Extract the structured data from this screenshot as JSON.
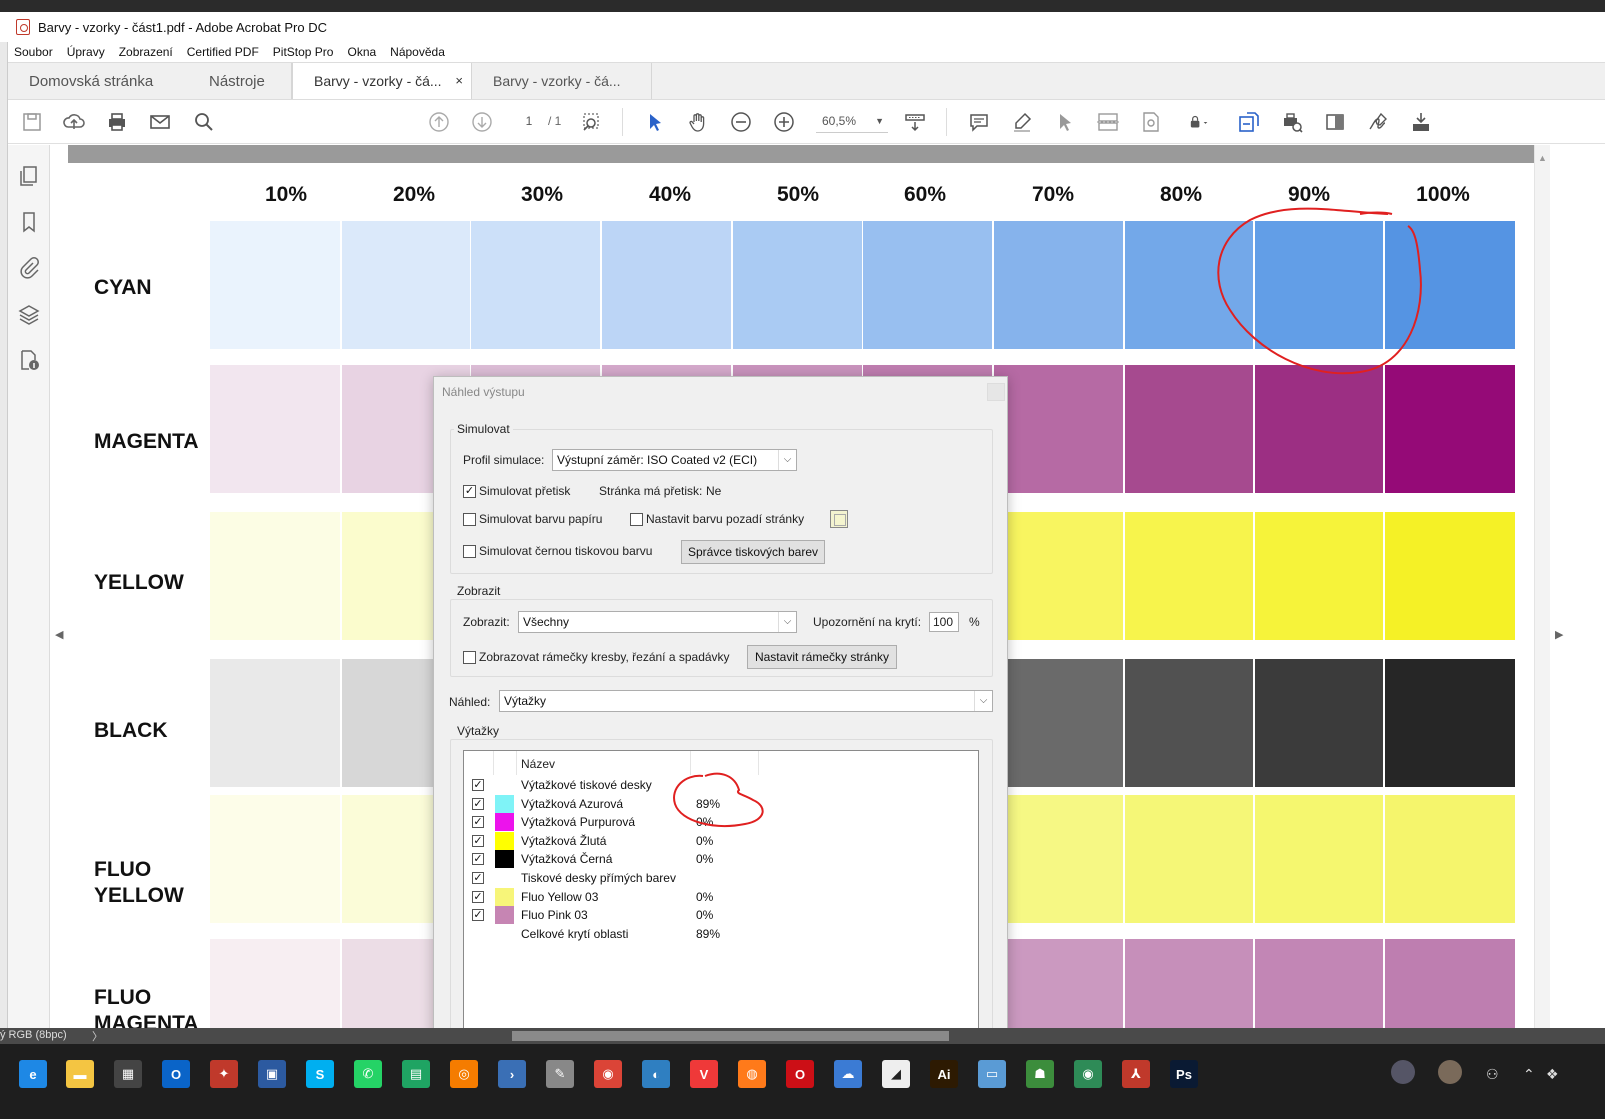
{
  "window": {
    "title": "Barvy - vzorky - část1.pdf - Adobe Acrobat Pro DC"
  },
  "menu": [
    "Soubor",
    "Úpravy",
    "Zobrazení",
    "Certified PDF",
    "PitStop Pro",
    "Okna",
    "Nápověda"
  ],
  "tabs": {
    "home": "Domovská stránka",
    "tools": "Nástroje",
    "doc1": "Barvy - vzorky - čá...",
    "doc2": "Barvy - vzorky - čá...",
    "close": "×"
  },
  "toolbar": {
    "page_current": "1",
    "page_total": "/ 1",
    "zoom": "60,5%"
  },
  "document": {
    "percent_headers": [
      "10%",
      "20%",
      "30%",
      "40%",
      "50%",
      "60%",
      "70%",
      "80%",
      "90%",
      "100%"
    ],
    "rows": [
      {
        "label": "CYAN",
        "colors": [
          "#eaf3fd",
          "#dbe9fa",
          "#cce0f9",
          "#bcd5f6",
          "#aacbf3",
          "#98bff0",
          "#86b3ec",
          "#73a8e9",
          "#629ee7",
          "#5594e3"
        ]
      },
      {
        "label": "MAGENTA",
        "colors": [
          "#f2e6ef",
          "#e8d3e3",
          "#dcbdd6",
          "#d4a9cb",
          "#c993bd",
          "#bf7db0",
          "#b66aa4",
          "#a64a8f",
          "#9c2f83",
          "#950a77"
        ]
      },
      {
        "label": "YELLOW",
        "colors": [
          "#fcfde4",
          "#fbfccd",
          "#fbfbb7",
          "#faf9a0",
          "#f9f88a",
          "#f8f675",
          "#f8f560",
          "#f7f44c",
          "#f6f33a",
          "#f5f126"
        ]
      },
      {
        "label": "BLACK",
        "colors": [
          "#e9e9e9",
          "#d7d7d7",
          "#c4c4c4",
          "#b2b2b2",
          "#9c9c9c",
          "#878787",
          "#6a6a6a",
          "#515151",
          "#3b3b3b",
          "#262626"
        ]
      },
      {
        "label": "FLUO YELLOW",
        "colors": [
          "#fdfde9",
          "#fbfcd8",
          "#fafcc6",
          "#f9fbb6",
          "#f8faa4",
          "#f7f993",
          "#f6f884",
          "#f5f777",
          "#f5f76f",
          "#f5f56c"
        ]
      },
      {
        "label": "FLUO MAGENTA",
        "colors": [
          "#f7eef2",
          "#ecdde6",
          "#e5cfdd",
          "#dec0d5",
          "#d7b1cc",
          "#d0a3c4",
          "#cb99c0",
          "#c68fba",
          "#c286b5",
          "#be7eb0"
        ]
      }
    ]
  },
  "dialog": {
    "title": "Náhled výstupu",
    "simulate": {
      "group": "Simulovat",
      "profile_label": "Profil simulace:",
      "profile_value": "Výstupní záměr: ISO Coated v2 (ECI)",
      "overprint": "Simulovat přetisk",
      "page_overprint_label": "Stránka má přetisk:",
      "page_overprint_value": "Ne",
      "paper_color": "Simulovat barvu papíru",
      "bg_color": "Nastavit barvu pozadí stránky",
      "black_ink": "Simulovat černou tiskovou barvu",
      "ink_manager": "Správce tiskových barev"
    },
    "display": {
      "group": "Zobrazit",
      "show_label": "Zobrazit:",
      "show_value": "Všechny",
      "coverage_label": "Upozornění na krytí:",
      "coverage_value": "100",
      "coverage_unit": "%",
      "boxes": "Zobrazovat rámečky kresby, řezání a spadávky",
      "page_boxes": "Nastavit rámečky stránky"
    },
    "preview_label": "Náhled:",
    "preview_value": "Výtažky",
    "separations": {
      "group": "Výtažky",
      "col_name": "Název",
      "rows": [
        {
          "name": "Výtažkové tiskové desky",
          "pct": "",
          "color": "",
          "checked": true
        },
        {
          "name": "Výtažková Azurová",
          "pct": "89%",
          "color": "#7ff3f7",
          "checked": true
        },
        {
          "name": "Výtažková Purpurová",
          "pct": "0%",
          "color": "#ec13ec",
          "checked": true
        },
        {
          "name": "Výtažková Žlutá",
          "pct": "0%",
          "color": "#ffff00",
          "checked": true
        },
        {
          "name": "Výtažková Černá",
          "pct": "0%",
          "color": "#000000",
          "checked": true
        },
        {
          "name": "Tiskové desky přímých barev",
          "pct": "",
          "color": "",
          "checked": true
        },
        {
          "name": "Fluo Yellow 03",
          "pct": "0%",
          "color": "#f7f579",
          "checked": true
        },
        {
          "name": "Fluo Pink 03",
          "pct": "0%",
          "color": "#c685b3",
          "checked": true
        },
        {
          "name": "Celkové krytí oblasti",
          "pct": "89%",
          "color": "",
          "checked": false
        }
      ]
    }
  },
  "statusbar": {
    "text": "ý RGB (8bpc)"
  },
  "taskbar": {
    "apps": [
      {
        "name": "edge",
        "label": "e",
        "color": "#1e88e5"
      },
      {
        "name": "explorer",
        "label": "▬",
        "color": "#f4c542"
      },
      {
        "name": "store",
        "label": "▦",
        "color": "#444"
      },
      {
        "name": "outlook",
        "label": "O",
        "color": "#0a64c8"
      },
      {
        "name": "app-red",
        "label": "✦",
        "color": "#c0392b"
      },
      {
        "name": "save-app",
        "label": "▣",
        "color": "#2c5aa0"
      },
      {
        "name": "skype",
        "label": "S",
        "color": "#00aff0"
      },
      {
        "name": "whatsapp",
        "label": "✆",
        "color": "#25d366"
      },
      {
        "name": "sheets",
        "label": "▤",
        "color": "#1fa463"
      },
      {
        "name": "app-orange",
        "label": "◎",
        "color": "#f57c00"
      },
      {
        "name": "powershell",
        "label": "›",
        "color": "#3a6fb5"
      },
      {
        "name": "paint",
        "label": "✎",
        "color": "#888"
      },
      {
        "name": "chrome",
        "label": "◉",
        "color": "#db4437"
      },
      {
        "name": "app-blue",
        "label": "◐",
        "color": "#2f7fc1"
      },
      {
        "name": "vivaldi",
        "label": "V",
        "color": "#ef3939"
      },
      {
        "name": "firefox",
        "label": "◍",
        "color": "#ff7a1a"
      },
      {
        "name": "opera",
        "label": "O",
        "color": "#cc0f16"
      },
      {
        "name": "app-cloud",
        "label": "☁",
        "color": "#3b7bd4"
      },
      {
        "name": "notes",
        "label": "◢",
        "color": "#eee"
      },
      {
        "name": "illustrator",
        "label": "Ai",
        "color": "#2d1a02"
      },
      {
        "name": "monitor",
        "label": "▭",
        "color": "#5a9bd5"
      },
      {
        "name": "app-green",
        "label": "☗",
        "color": "#3c8d3c"
      },
      {
        "name": "eye-app",
        "label": "◉",
        "color": "#2e8b57"
      },
      {
        "name": "acrobat",
        "label": "⅄",
        "color": "#c0392b"
      },
      {
        "name": "photoshop",
        "label": "Ps",
        "color": "#0a1a33"
      }
    ]
  }
}
